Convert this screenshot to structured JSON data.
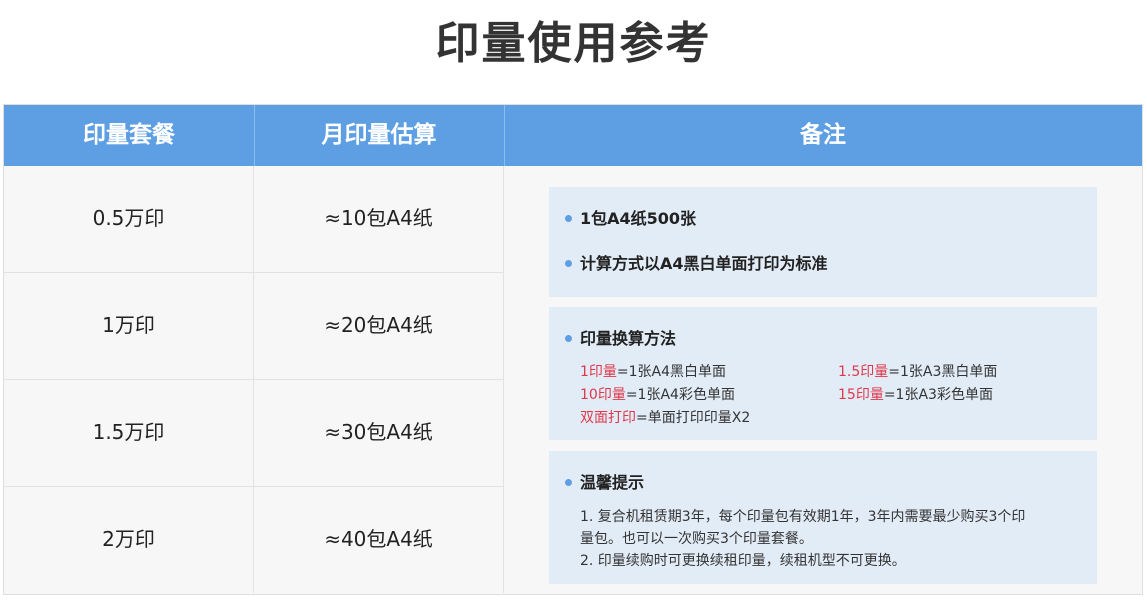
{
  "title": "印量使用参考",
  "headers": {
    "plan": "印量套餐",
    "monthly": "月印量估算",
    "notes": "备注"
  },
  "rows": [
    {
      "plan": "0.5万印",
      "monthly": "≈10包A4纸"
    },
    {
      "plan": "1万印",
      "monthly": "≈20包A4纸"
    },
    {
      "plan": "1.5万印",
      "monthly": "≈30包A4纸"
    },
    {
      "plan": "2万印",
      "monthly": "≈40包A4纸"
    }
  ],
  "notes": {
    "box1": {
      "item1": "1包A4纸500张",
      "item2": "计算方式以A4黑白单面打印为标准"
    },
    "box2": {
      "heading": "印量换算方法",
      "conv": [
        {
          "red": "1印量",
          "rest": "=1张A4黑白单面"
        },
        {
          "red": "1.5印量",
          "rest": "=1张A3黑白单面"
        },
        {
          "red": "10印量",
          "rest": "=1张A4彩色单面"
        },
        {
          "red": "15印量",
          "rest": "=1张A3彩色单面"
        },
        {
          "red": "双面打印",
          "rest": "=单面打印印量X2"
        }
      ]
    },
    "box3": {
      "heading": "温馨提示",
      "line1": "1. 复合机租赁期3年，每个印量包有效期1年，3年内需要最少购买3个印",
      "line2": "量包。也可以一次购买3个印量套餐。",
      "line3": "2. 印量续购时可更换续租印量，续租机型不可更换。"
    }
  },
  "colors": {
    "header": "#5e9fe3",
    "note_box": "#e2ecf7",
    "highlight": "#e0374a"
  }
}
